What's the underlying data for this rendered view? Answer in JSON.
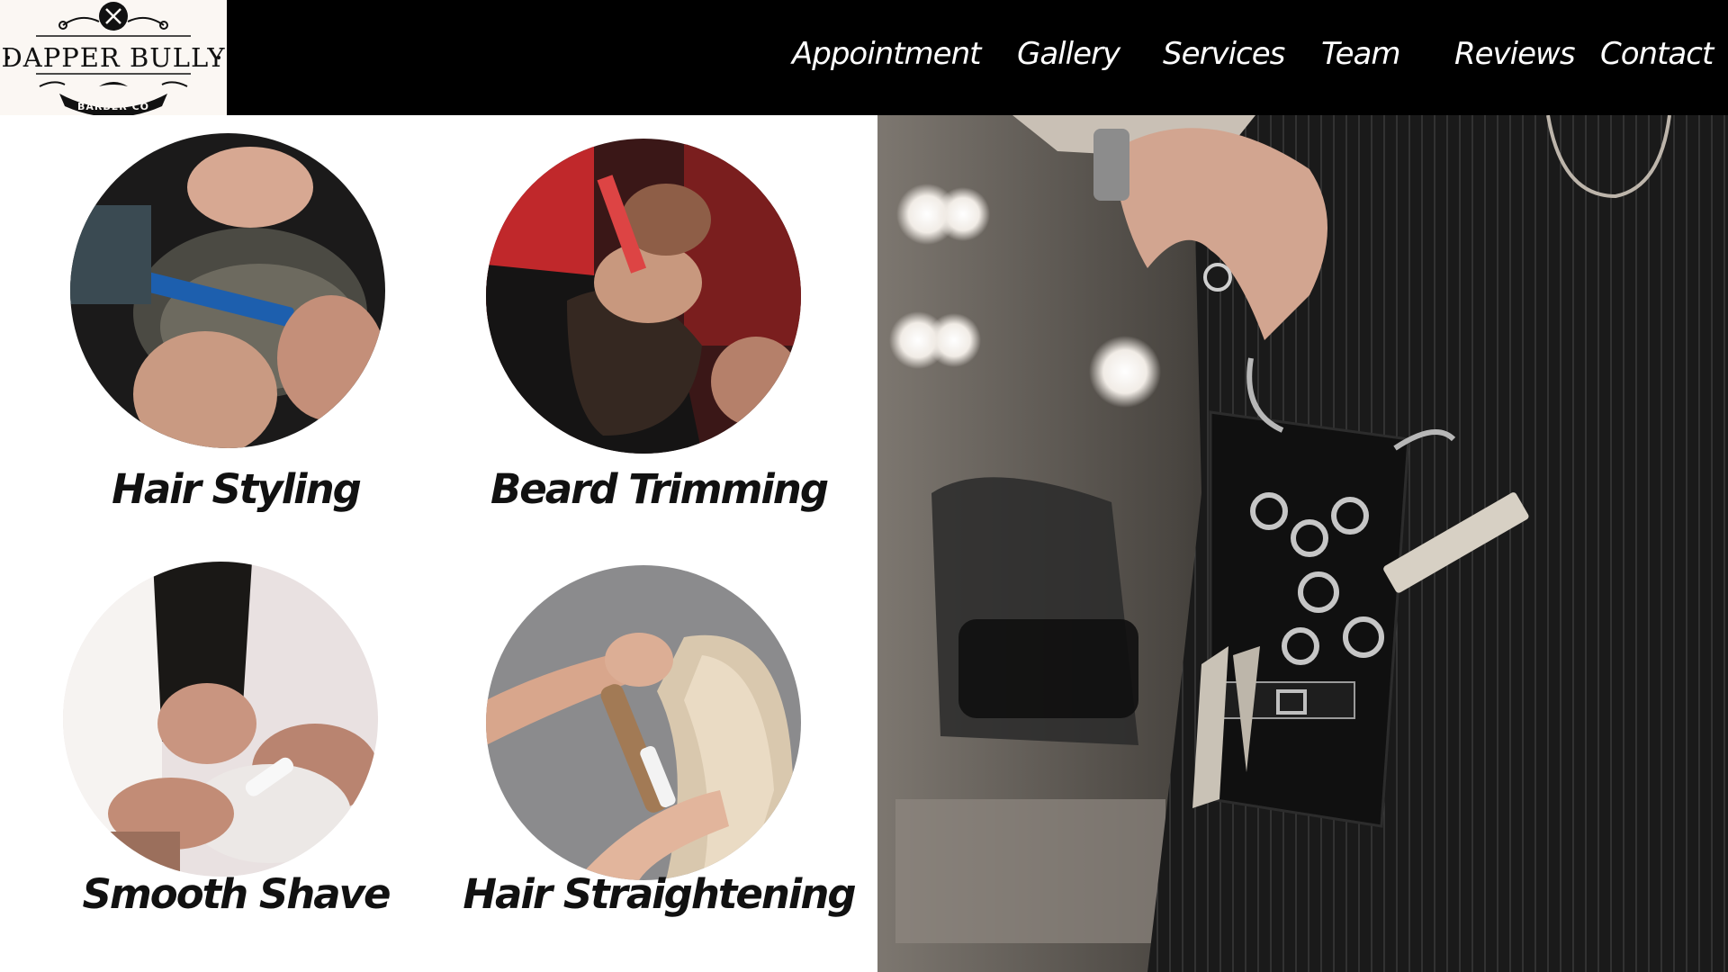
{
  "brand": {
    "name": "DAPPER BULLY",
    "tagline": "BARBER CO"
  },
  "nav": {
    "items": [
      {
        "label": "Appointment"
      },
      {
        "label": "Gallery"
      },
      {
        "label": "Services"
      },
      {
        "label": "Team"
      },
      {
        "label": "Reviews"
      },
      {
        "label": "Contact"
      }
    ]
  },
  "services": [
    {
      "title": "Hair Styling",
      "image_icon": "haircut-photo-icon"
    },
    {
      "title": "Beard Trimming",
      "image_icon": "beard-trim-photo-icon"
    },
    {
      "title": "Smooth Shave",
      "image_icon": "shave-photo-icon"
    },
    {
      "title": "Hair Straightening",
      "image_icon": "straightening-photo-icon"
    }
  ],
  "hero": {
    "image_icon": "barber-tool-belt-photo-icon"
  },
  "colors": {
    "header_bg": "#000000",
    "page_bg": "#ffffff",
    "text": "#111111",
    "logo_bg": "#fbf7f3"
  }
}
